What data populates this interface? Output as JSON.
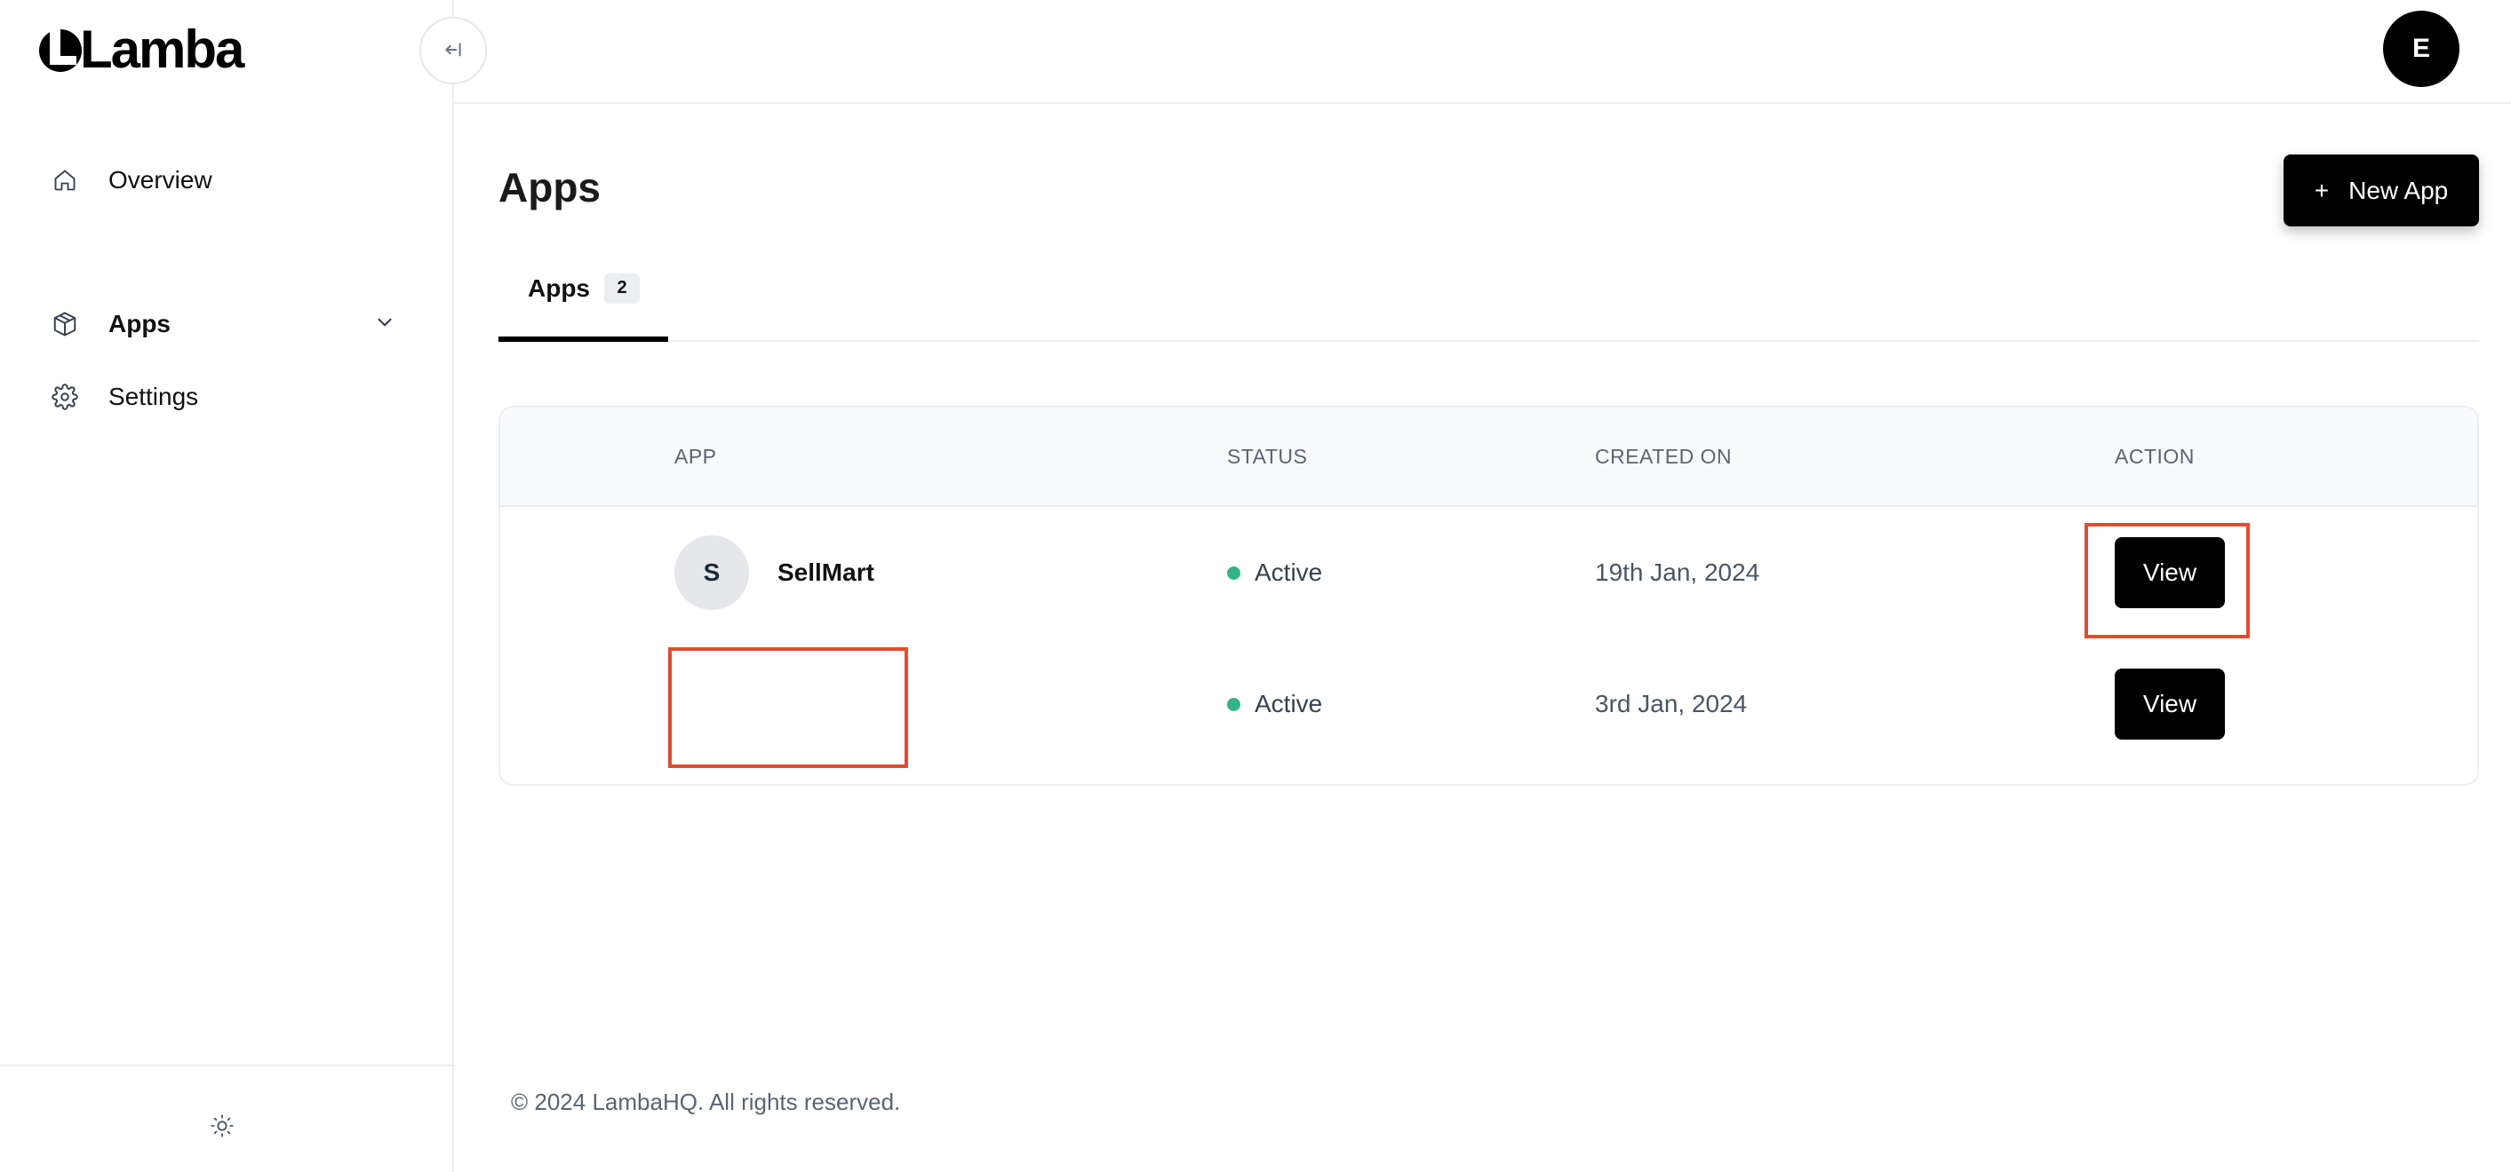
{
  "brand": {
    "logo_text": "Lamba"
  },
  "sidebar": {
    "items": [
      {
        "label": "Overview",
        "icon": "home-icon"
      },
      {
        "label": "Apps",
        "icon": "cube-icon",
        "active": true
      },
      {
        "label": "Settings",
        "icon": "gear-icon"
      }
    ],
    "collapse_icon": "collapse-left-icon",
    "theme_icon": "sun-icon"
  },
  "header": {
    "avatar_initial": "E"
  },
  "main": {
    "title": "Apps",
    "new_app_button": {
      "icon": "+",
      "label": "New App"
    },
    "tabs": [
      {
        "label": "Apps",
        "count": "2"
      }
    ],
    "table": {
      "columns": [
        "APP",
        "STATUS",
        "CREATED ON",
        "ACTION"
      ],
      "rows": [
        {
          "initial": "S",
          "name": "SellMart",
          "status": "Active",
          "created": "19th Jan, 2024",
          "action": "View"
        },
        {
          "initial": "",
          "name": "",
          "status": "Active",
          "created": "3rd Jan, 2024",
          "action": "View"
        }
      ]
    }
  },
  "colors": {
    "accent": "#000000",
    "status_active": "#34b38a",
    "highlight": "#e34b2f"
  },
  "footer": {
    "copyright": "© 2024 LambaHQ. All rights reserved."
  }
}
